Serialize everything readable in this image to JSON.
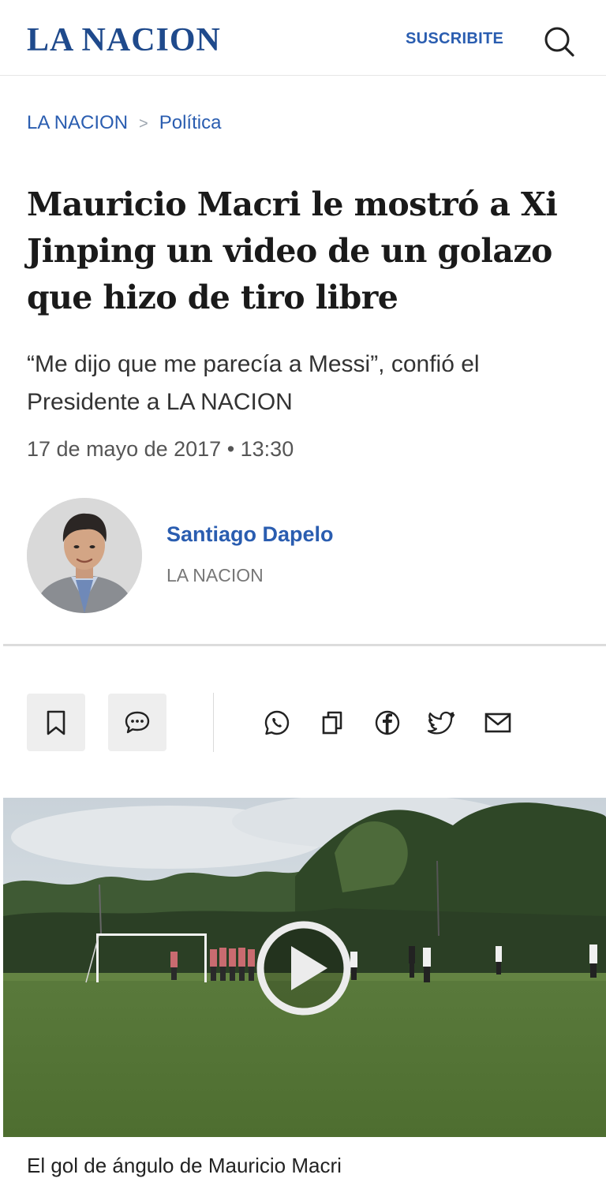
{
  "header": {
    "logo": "LA NACION",
    "subscribe_label": "SUSCRIBITE",
    "search_icon": "search-icon"
  },
  "breadcrumb": {
    "items": [
      "LA NACION",
      "Política"
    ],
    "separator": ">"
  },
  "article": {
    "title": "Mauricio Macri le mostró a Xi Jinping un video de un golazo que hizo de tiro libre",
    "subtitle": "“Me dijo que me parecía a Messi”, confió el Presidente a LA NACION",
    "dateline": "17 de mayo de 2017 • 13:30"
  },
  "author": {
    "name": "Santiago Dapelo",
    "organization": "LA NACION"
  },
  "actions": {
    "bookmark_icon": "bookmark-icon",
    "comments_icon": "comment-icon",
    "share_icons": [
      "whatsapp-icon",
      "copy-icon",
      "facebook-icon",
      "twitter-icon",
      "email-icon"
    ]
  },
  "media": {
    "play_icon": "play-icon",
    "caption": "El gol de ángulo de Mauricio Macri"
  },
  "colors": {
    "brand": "#1f4a8c",
    "link": "#2a5db0",
    "text": "#1a1a1a",
    "muted": "#777777"
  }
}
